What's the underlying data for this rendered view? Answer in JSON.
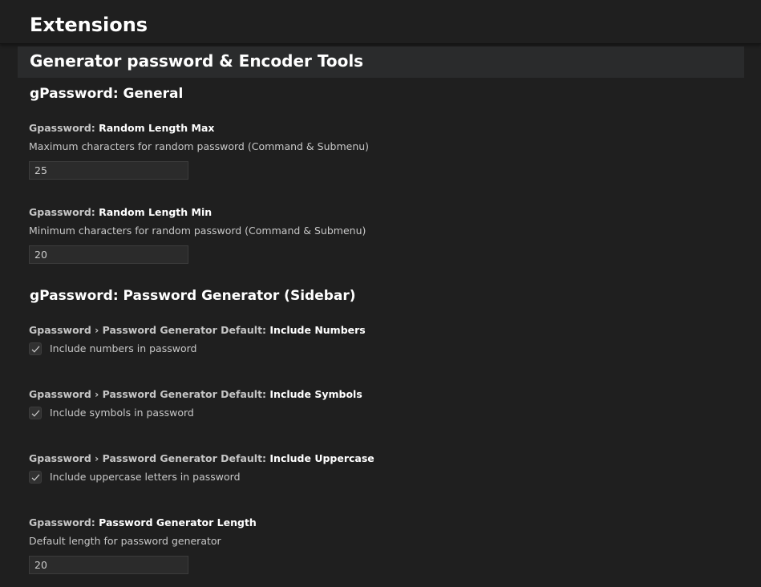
{
  "header": {
    "title": "Extensions"
  },
  "section": {
    "title": "Generator password & Encoder Tools"
  },
  "groups": [
    {
      "title": "gPassword: General",
      "settings": [
        {
          "category": "Gpassword: ",
          "key": "Random Length Max",
          "description": "Maximum characters for random password (Command & Submenu)",
          "value": "25"
        },
        {
          "category": "Gpassword: ",
          "key": "Random Length Min",
          "description": "Minimum characters for random password (Command & Submenu)",
          "value": "20"
        }
      ]
    },
    {
      "title": "gPassword: Password Generator (Sidebar)",
      "settings": [
        {
          "category": "Gpassword › Password Generator Default: ",
          "key": "Include Numbers",
          "checkbox_label": "Include numbers in password",
          "checked": true
        },
        {
          "category": "Gpassword › Password Generator Default: ",
          "key": "Include Symbols",
          "checkbox_label": "Include symbols in password",
          "checked": true
        },
        {
          "category": "Gpassword › Password Generator Default: ",
          "key": "Include Uppercase",
          "checkbox_label": "Include uppercase letters in password",
          "checked": true
        },
        {
          "category": "Gpassword: ",
          "key": "Password Generator Length",
          "description": "Default length for password generator",
          "value": "20"
        }
      ]
    }
  ],
  "colors": {
    "background": "#1f1f1f",
    "section_bar": "#2a2b2c",
    "input_background": "#2b2b2b",
    "input_border": "#3c3c3c"
  },
  "icons": {
    "checkmark": "check-icon"
  }
}
